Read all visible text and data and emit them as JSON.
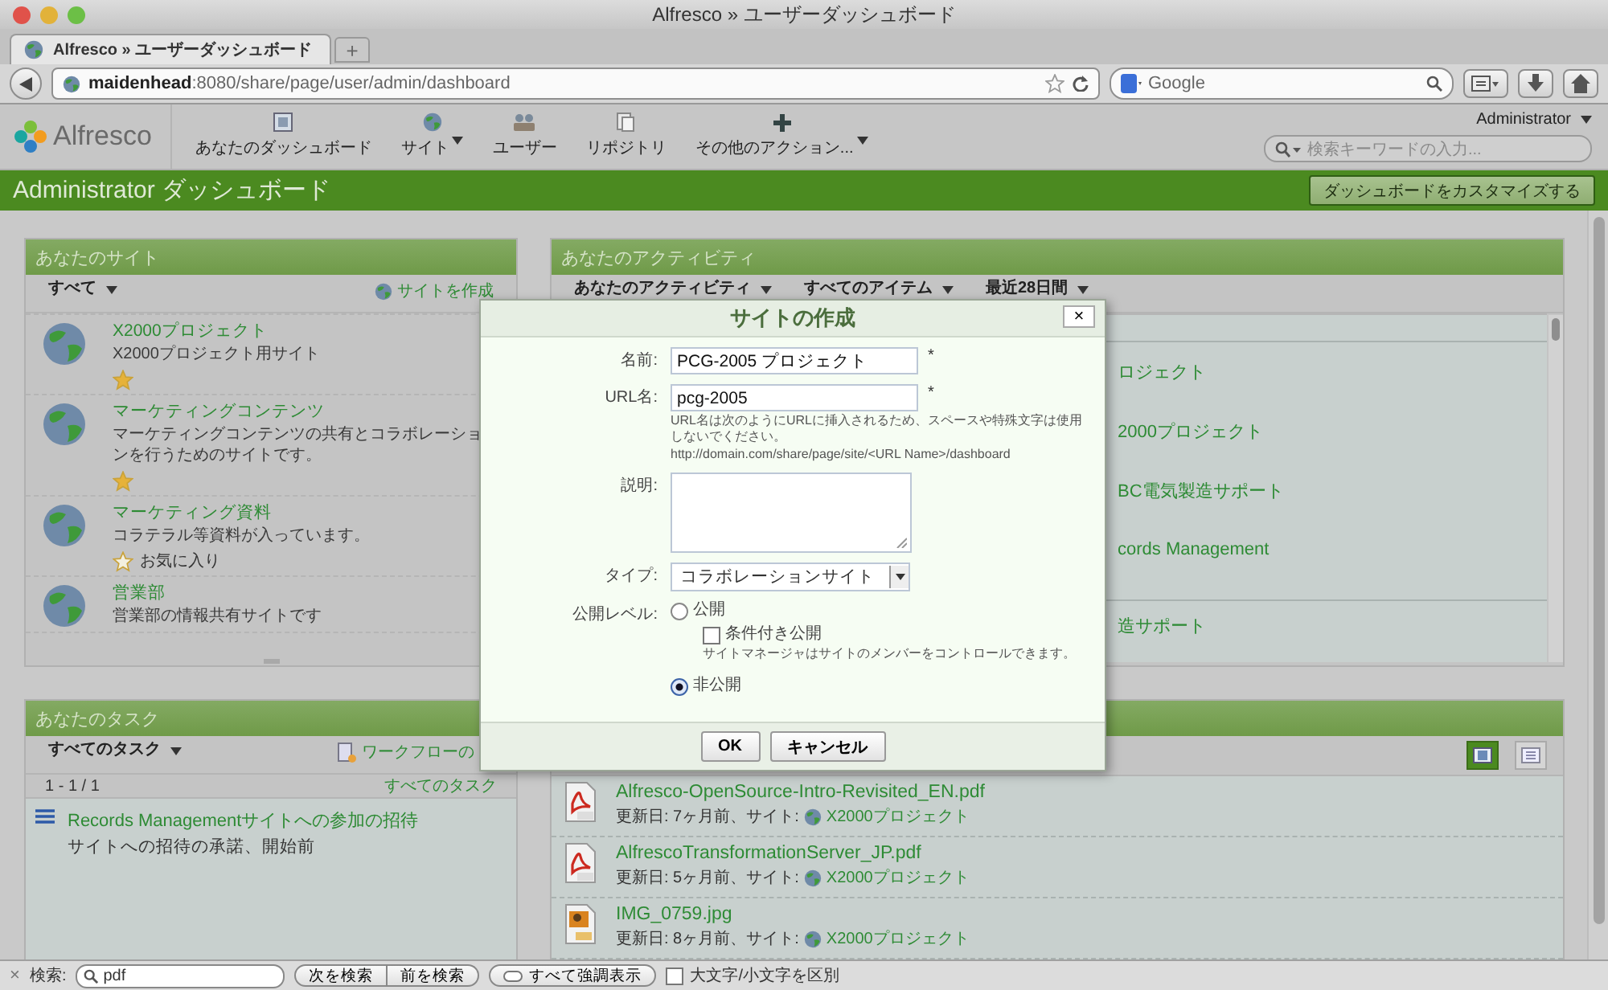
{
  "window": {
    "title": "Alfresco » ユーザーダッシュボード"
  },
  "tabs": [
    {
      "label": "Alfresco » ユーザーダッシュボード",
      "selected": true
    }
  ],
  "new_tab": "+",
  "address_bar": {
    "url": "**maidenhead**:8080/share/page/user/admin/dashboard"
  },
  "search_bar": {
    "placeholder": "Google"
  },
  "app_header": {
    "logo": "Alfresco",
    "user": "Administrator",
    "search_placeholder": "検索キーワードの入力...",
    "menu": [
      {
        "label": "あなたのダッシュボード",
        "kind": "dashboard",
        "dropdown": false
      },
      {
        "label": "サイト",
        "kind": "sites",
        "dropdown": true
      },
      {
        "label": "ユーザー",
        "kind": "people",
        "dropdown": false
      },
      {
        "label": "リポジトリ",
        "kind": "repository",
        "dropdown": false
      },
      {
        "label": "その他のアクション...",
        "kind": "more",
        "dropdown": true
      }
    ]
  },
  "title_bar": {
    "title": "Administrator ダッシュボード",
    "customize_button": "ダッシュボードをカスタマイズする"
  },
  "sites_panel": {
    "title": "あなたのサイト",
    "filter": "すべて",
    "create_link": "サイトを作成",
    "sites": [
      {
        "name": "X2000プロジェクト",
        "description": "X2000プロジェクト用サイト",
        "favorite": true
      },
      {
        "name": "マーケティングコンテンツ",
        "description": "マーケティングコンテンツの共有とコラボレーションを行うためのサイトです。",
        "favorite": true
      },
      {
        "name": "マーケティング資料",
        "description": "コラテラル等資料が入っています。",
        "favorite": false,
        "favorite_label": "お気に入り"
      },
      {
        "name": "営業部",
        "description": "営業部の情報共有サイトです"
      }
    ]
  },
  "tasks_panel": {
    "title": "あなたのタスク",
    "filter": "すべてのタスク",
    "workflow_link": "ワークフローの",
    "pagination": "1 - 1 / 1",
    "all_tasks_link": "すべてのタスク",
    "tasks": [
      {
        "title": "Records Managementサイトへの参加の招待",
        "status": "サイトへの招待の承諾、開始前"
      }
    ]
  },
  "activity_panel": {
    "title": "あなたのアクティビティ",
    "filters": [
      "あなたのアクティビティ",
      "すべてのアイテム",
      "最近28日間"
    ],
    "items": [
      "ロジェクト",
      "2000プロジェクト",
      "BC電気製造サポート",
      "cords Management",
      "造サポート"
    ]
  },
  "documents_panel": {
    "views": [
      {
        "kind": "detailed",
        "selected": true
      },
      {
        "kind": "simple",
        "selected": false
      }
    ],
    "documents": [
      {
        "kind": "pdf",
        "name": "Alfresco-OpenSource-Intro-Revisited_EN.pdf",
        "meta": "更新日: 7ヶ月前、サイト:",
        "site": "X2000プロジェクト"
      },
      {
        "kind": "pdf",
        "name": "AlfrescoTransformationServer_JP.pdf",
        "meta": "更新日: 5ヶ月前、サイト:",
        "site": "X2000プロジェクト"
      },
      {
        "kind": "image",
        "name": "IMG_0759.jpg",
        "meta": "更新日: 8ヶ月前、サイト:",
        "site": "X2000プロジェクト"
      }
    ]
  },
  "dialog": {
    "title": "サイトの作成",
    "close": "×",
    "required_mark": "*",
    "fields": [
      {
        "kind": "text",
        "label": "名前:",
        "value": "PCG-2005 プロジェクト",
        "required": true
      },
      {
        "kind": "text",
        "label": "URL名:",
        "value": "pcg-2005",
        "required": true,
        "help": "URL名は次のようにURLに挿入されるため、スペースや特殊文字は使用しないでください。",
        "example": "http://domain.com/share/page/site/<URL Name>/dashboard"
      },
      {
        "kind": "textarea",
        "label": "説明:"
      },
      {
        "kind": "select",
        "label": "タイプ:",
        "value": "コラボレーションサイト"
      }
    ],
    "visibility": {
      "label": "公開レベル:",
      "options": [
        {
          "label": "公開",
          "selected": false
        },
        {
          "label": "非公開",
          "selected": true
        }
      ],
      "moderated": {
        "label": "条件付き公開",
        "checked": false,
        "help": "サイトマネージャはサイトのメンバーをコントロールできます。"
      }
    },
    "buttons": [
      "OK",
      "キャンセル"
    ]
  },
  "find_bar": {
    "close": "×",
    "label": "検索:",
    "value": "pdf",
    "next": "次を検索",
    "previous": "前を検索",
    "highlight_all": "すべて強調表示",
    "match_case": {
      "label": "大文字/小文字を区別",
      "checked": false
    }
  }
}
